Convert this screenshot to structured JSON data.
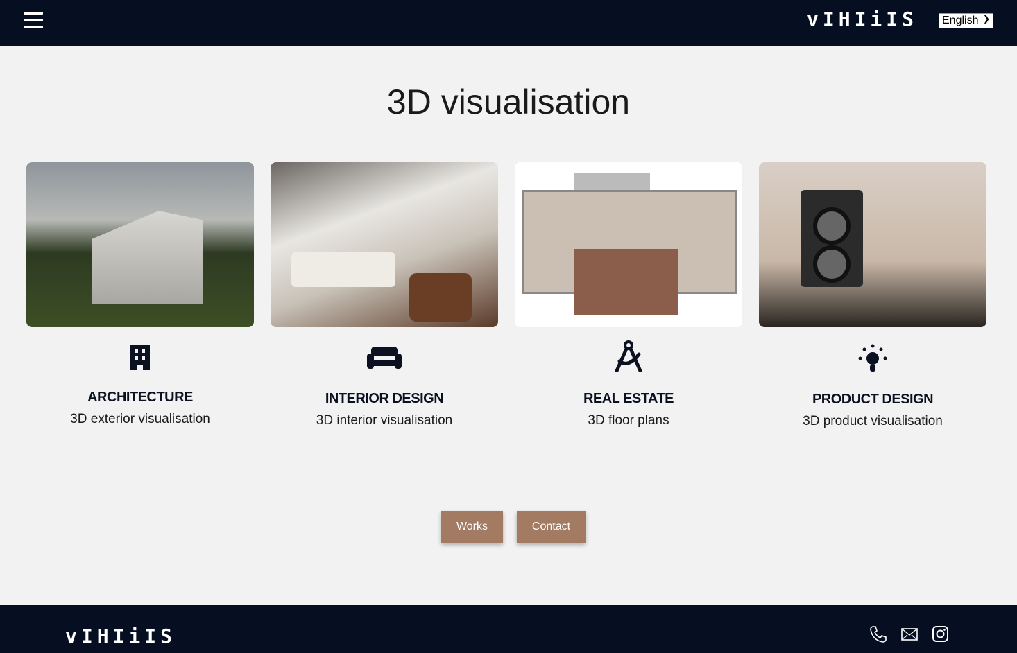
{
  "header": {
    "logo": "vIHIiIS",
    "language": "English",
    "menu_icon": "hamburger-icon"
  },
  "page_title": "3D visualisation",
  "cards": [
    {
      "title": "ARCHITECTURE",
      "subtitle": "3D exterior visualisation",
      "icon": "building-icon"
    },
    {
      "title": "INTERIOR DESIGN",
      "subtitle": "3D interior visualisation",
      "icon": "couch-icon"
    },
    {
      "title": "REAL ESTATE",
      "subtitle": "3D floor plans",
      "icon": "compass-drafting-icon"
    },
    {
      "title": "PRODUCT DESIGN",
      "subtitle": "3D product visualisation",
      "icon": "lightbulb-icon"
    }
  ],
  "buttons": {
    "works": "Works",
    "contact": "Contact"
  },
  "footer": {
    "logo": "vIHIiIS",
    "icons": [
      "phone-icon",
      "mail-icon",
      "instagram-icon"
    ]
  },
  "colors": {
    "navy": "#060f22",
    "button": "#a27b62",
    "background": "#f2f2f2"
  }
}
